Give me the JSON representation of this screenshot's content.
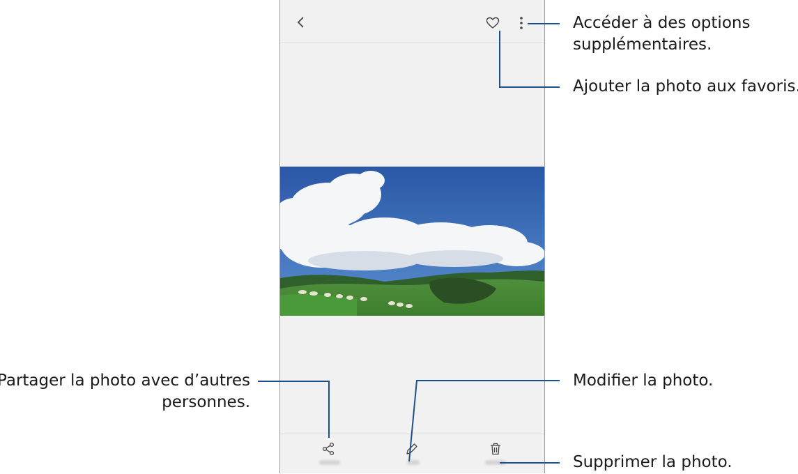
{
  "viewer": {
    "toolbar": {
      "back": "back-icon",
      "favorite": "heart-icon",
      "more": "more-options-icon"
    },
    "bottom_bar": {
      "share": "share-icon",
      "edit": "pencil-icon",
      "delete": "trash-icon"
    }
  },
  "callouts": {
    "more_options_line1": "Accéder à des options",
    "more_options_line2": "supplémentaires.",
    "favorite": "Ajouter la photo aux favoris.",
    "share_line1": "Partager la photo avec d’autres",
    "share_line2": "personnes.",
    "edit": "Modifier la photo.",
    "delete": "Supprimer la photo."
  },
  "colors": {
    "sky": "#2f5fae",
    "grass": "#3f8a35",
    "callout_line": "#1f4e8c"
  }
}
